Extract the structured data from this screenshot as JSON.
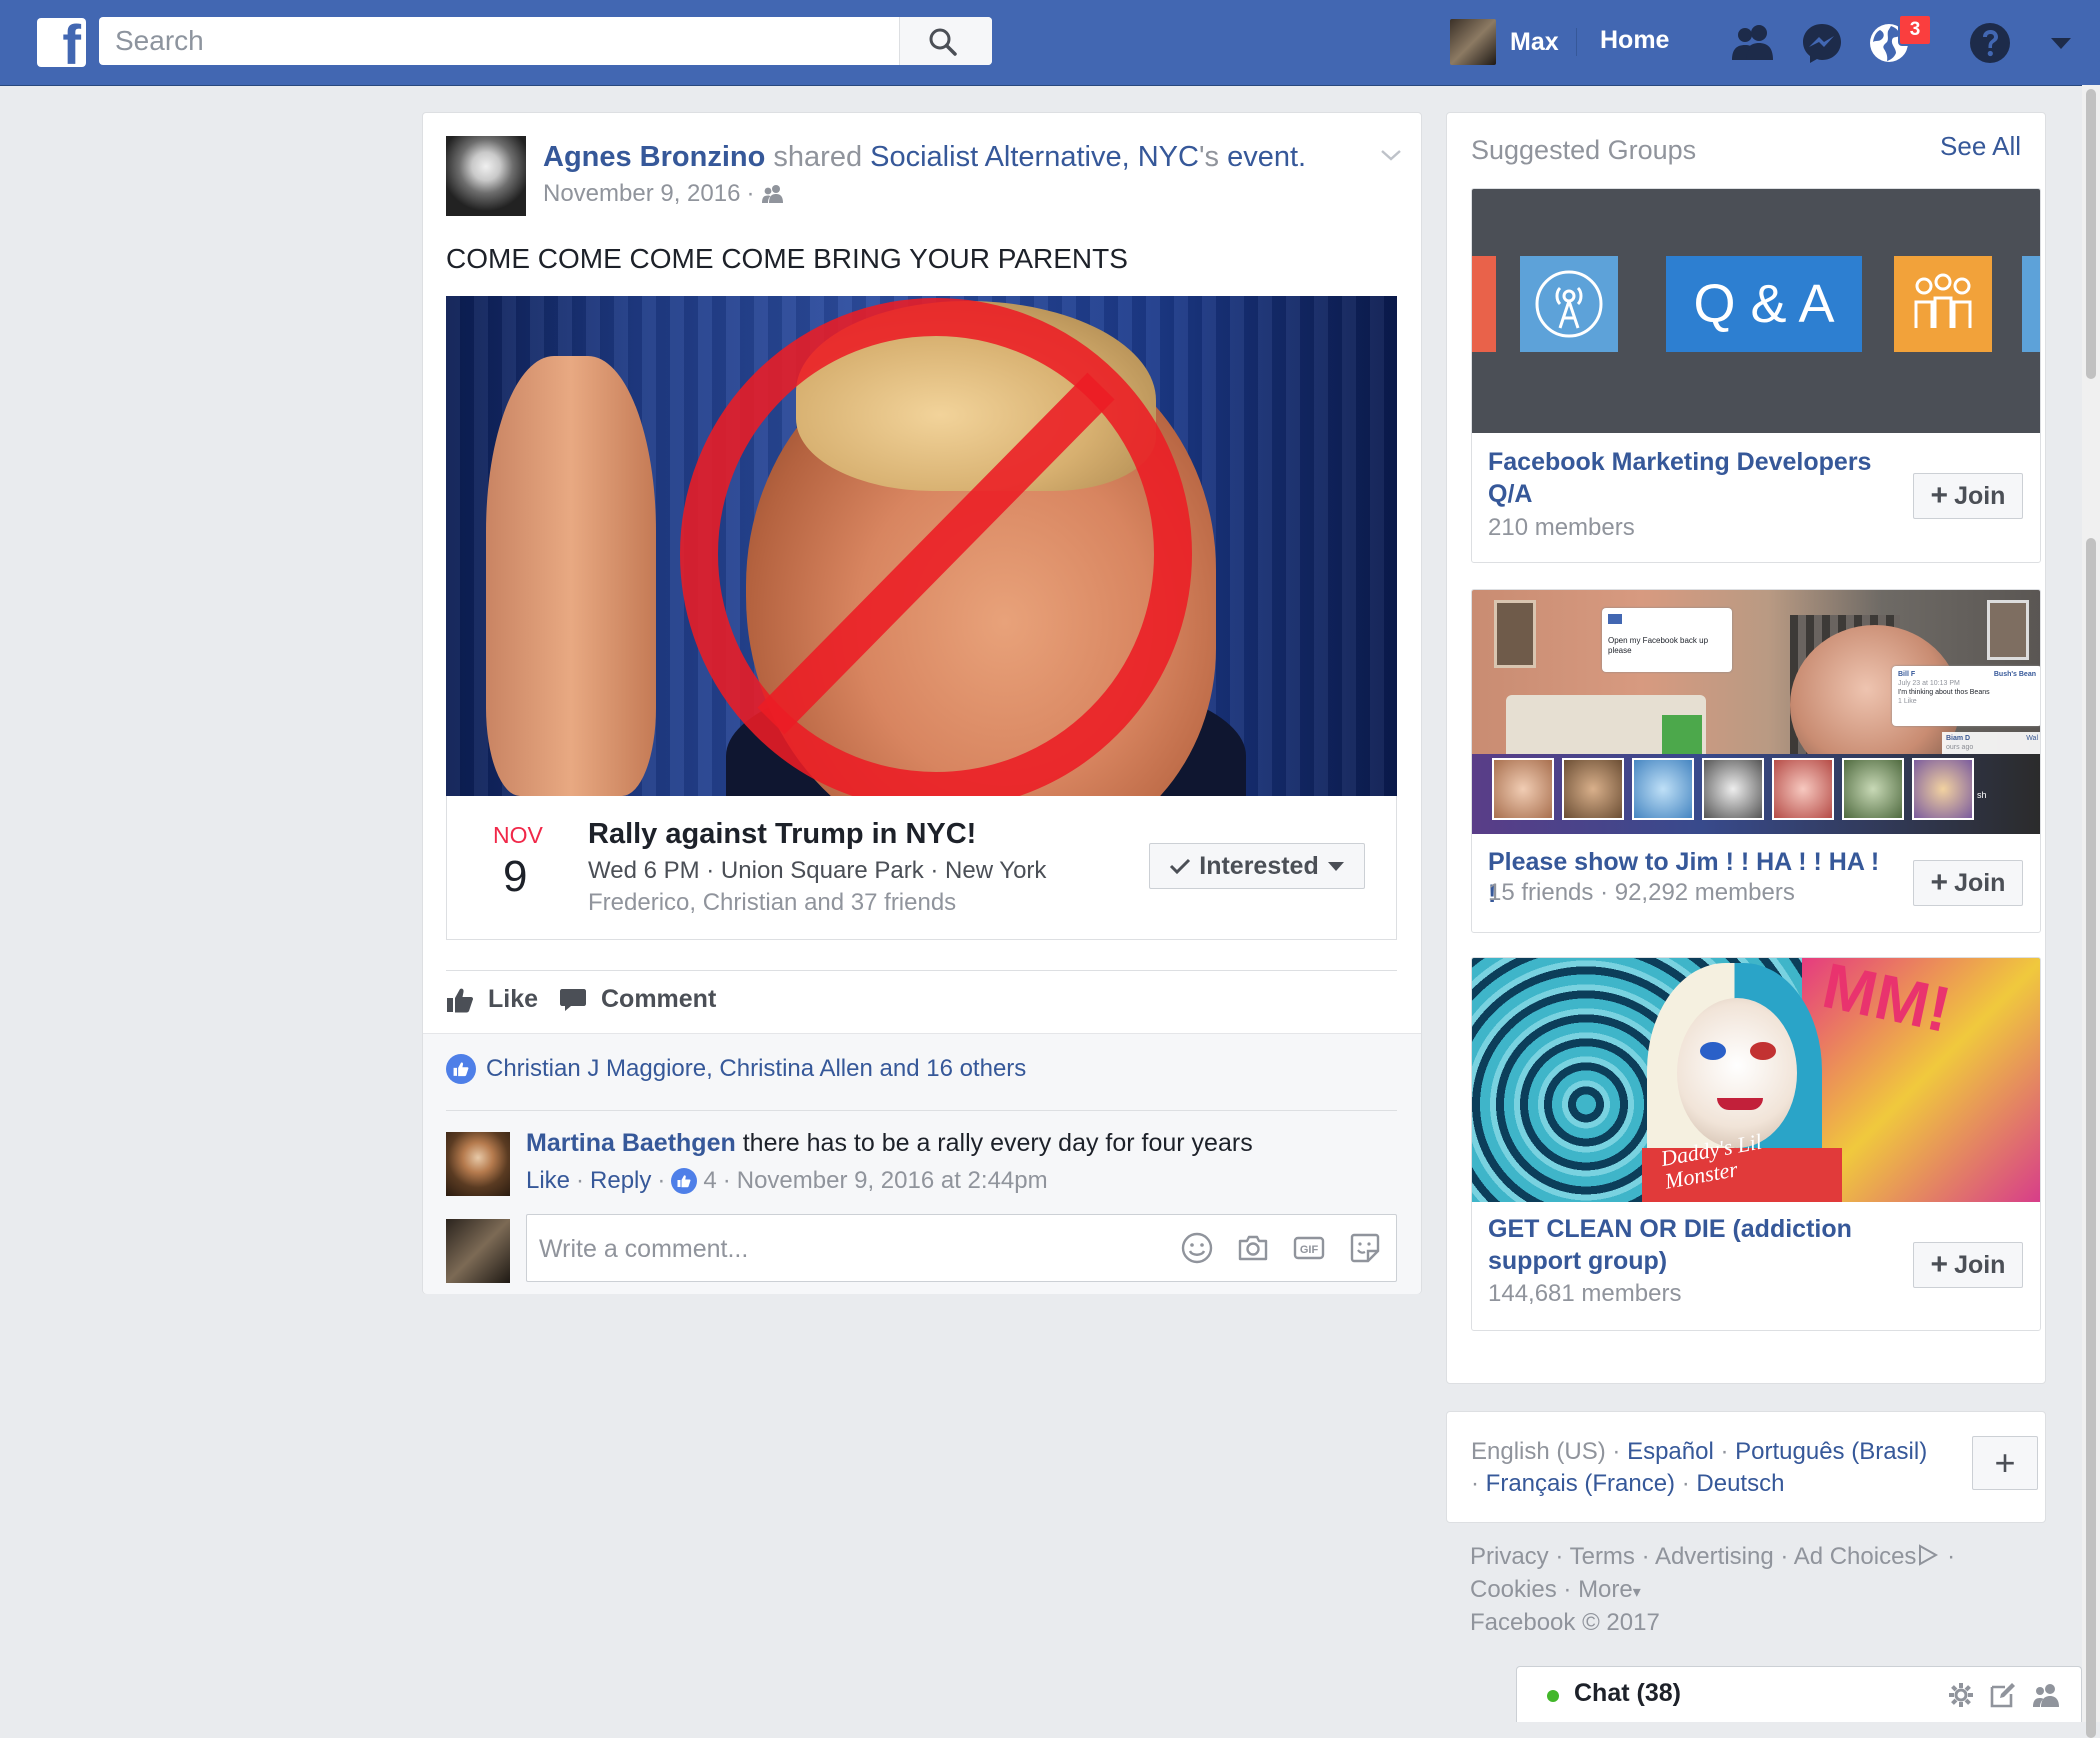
{
  "topbar": {
    "search_placeholder": "Search",
    "user_name": "Max",
    "home_label": "Home",
    "notification_count": "3"
  },
  "post": {
    "author": "Agnes Bronzino",
    "verb": "shared",
    "shared_from": "Socialist Alternative, NYC",
    "possessive": "'s",
    "object": "event.",
    "date": "November 9, 2016",
    "date_separator": "·",
    "text": "COME COME COME COME BRING YOUR PARENTS",
    "event": {
      "month": "NOV",
      "day": "9",
      "title": "Rally against Trump in NYC!",
      "details": "Wed 6 PM · Union Square Park · New York",
      "friends": "Frederico, Christian and 37 friends",
      "interested_label": "Interested"
    },
    "actions": {
      "like": "Like",
      "comment": "Comment"
    },
    "likes_summary": "Christian J Maggiore, Christina Allen and 16 others",
    "comment": {
      "author": "Martina Baethgen",
      "text": "there has to be a rally every day for four years",
      "like": "Like",
      "reply": "Reply",
      "like_count": "4",
      "timestamp": "November 9, 2016 at 2:44pm",
      "sep": "·"
    },
    "write_placeholder": "Write a comment..."
  },
  "suggested_groups": {
    "title": "Suggested Groups",
    "see_all": "See All",
    "qa_tile": "Q & A",
    "join_label": "Join",
    "groups": [
      {
        "name": "Facebook Marketing Developers Q/A",
        "meta": "210 members"
      },
      {
        "name": "Please show to Jim ! ! HA ! ! HA ! !",
        "meta": "15 friends · 92,292 members"
      },
      {
        "name": "GET CLEAN OR DIE (addiction support group)",
        "meta": "144,681 members"
      }
    ],
    "jim_screenshot": {
      "bubble1": "Open my Facebook back up please",
      "bubble2_name": "Bill F",
      "bubble2_name_suffix": "Bush's Bean",
      "bubble2_time": "July 23 at 10:13 PM",
      "bubble2_text": "I'm thinking about thos Beans",
      "bubble2_likes": "1 Like",
      "bubble3_name": "Biam D",
      "bubble3_time": "ours ago",
      "bubble3_suffix": "Wal",
      "bubble4": "sh"
    },
    "harley_text": "Daddy's Lil Monster",
    "harley_wall": "MM!"
  },
  "languages": {
    "current": "English (US)",
    "others": [
      "Español",
      "Português (Brasil)",
      "Français (France)",
      "Deutsch"
    ],
    "sep": "·",
    "more": "+"
  },
  "footer": {
    "links": [
      "Privacy",
      "Terms",
      "Advertising",
      "Ad Choices",
      "Cookies",
      "More"
    ],
    "copyright": "Facebook © 2017",
    "sep": "·",
    "more_caret": "▾"
  },
  "chat": {
    "label": "Chat (38)"
  },
  "colors": {
    "brand_blue": "#4267b2",
    "link_blue": "#365899",
    "event_red": "#f02849",
    "online_green": "#42b72a",
    "badge_red": "#fa3e3e"
  }
}
